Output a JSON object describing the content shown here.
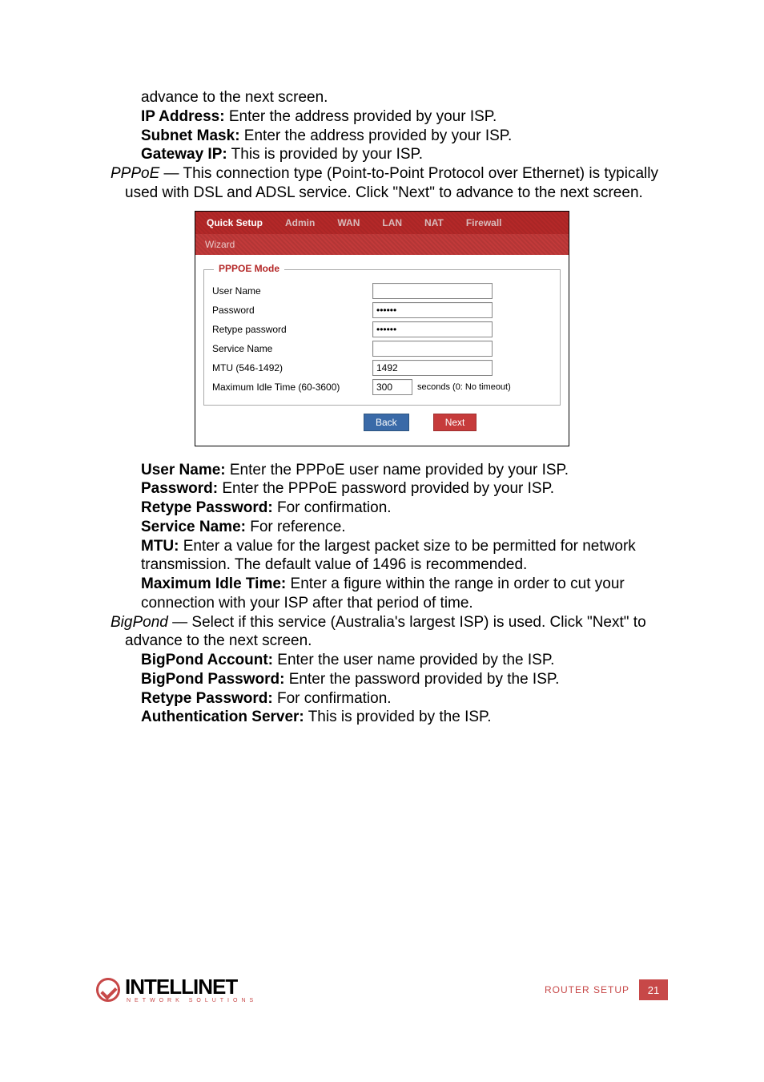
{
  "intro": {
    "advance": "advance to the next screen.",
    "ip_label": "IP Address:",
    "ip_text": " Enter the address provided by your ISP.",
    "subnet_label": "Subnet Mask:",
    "subnet_text": " Enter the address provided by your ISP.",
    "gateway_label": "Gateway IP:",
    "gateway_text": " This is provided by your ISP."
  },
  "pppoe_para": {
    "head": "PPPoE",
    "text": " — This connection type (Point-to-Point Protocol over Ethernet) is typically used with DSL and ADSL service. Click \"Next\" to advance to the next screen."
  },
  "shot": {
    "tabs": {
      "t0": "Quick Setup",
      "t1": "Admin",
      "t2": "WAN",
      "t3": "LAN",
      "t4": "NAT",
      "t5": "Firewall"
    },
    "subtab": "Wizard",
    "legend": "PPPOE Mode",
    "rows": {
      "user_label": "User Name",
      "user_val": "",
      "pw_label": "Password",
      "pw_val": "••••••",
      "rpw_label": "Retype password",
      "rpw_val": "••••••",
      "svc_label": "Service Name",
      "svc_val": "",
      "mtu_label": "MTU (546-1492)",
      "mtu_val": "1492",
      "idle_label": "Maximum Idle Time (60-3600)",
      "idle_val": "300",
      "idle_after": "seconds (0: No timeout)"
    },
    "btn_back": "Back",
    "btn_next": "Next"
  },
  "pppoe_fields": {
    "un_l": "User Name:",
    "un_t": " Enter the PPPoE user name provided by your ISP.",
    "pw_l": "Password:",
    "pw_t": " Enter the PPPoE password provided by your ISP.",
    "rp_l": "Retype Password:",
    "rp_t": " For confirmation.",
    "sn_l": "Service Name:",
    "sn_t": " For reference.",
    "mtu_l": "MTU:",
    "mtu_t": " Enter a value for the largest packet size to be permitted for network transmission. The default value of 1496 is recommended.",
    "idle_l": "Maximum Idle Time:",
    "idle_t": " Enter a figure within the range in order to cut your connection with your ISP after that period of time."
  },
  "bigpond_para": {
    "head": "BigPond",
    "text": " — Select if this service (Australia's largest ISP) is used. Click \"Next\" to advance to the next screen."
  },
  "bigpond_fields": {
    "acc_l": "BigPond Account:",
    "acc_t": " Enter the user name provided by the ISP.",
    "pw_l": "BigPond Password:",
    "pw_t": " Enter the password provided by the ISP.",
    "rp_l": "Retype Password:",
    "rp_t": " For confirmation.",
    "auth_l": "Authentication Server:",
    "auth_t": " This is provided by the ISP."
  },
  "footer": {
    "logo_main": "INTELLINET",
    "logo_sub": "NETWORK SOLUTIONS",
    "section": "ROUTER SETUP",
    "page": "21"
  }
}
